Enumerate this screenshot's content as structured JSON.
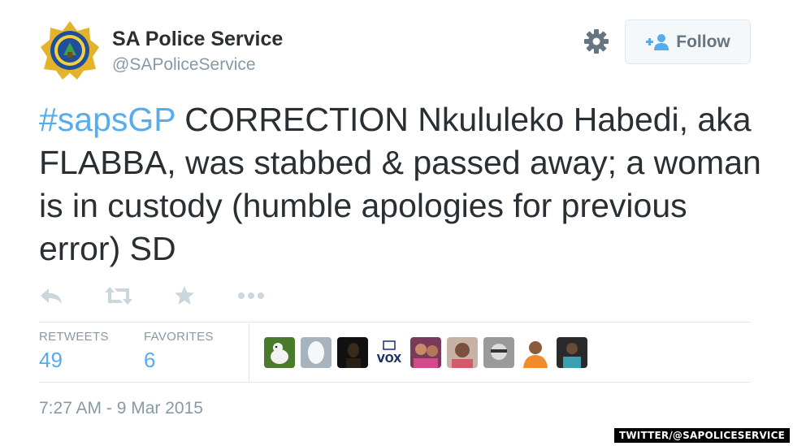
{
  "account": {
    "display_name": "SA Police Service",
    "handle": "@SAPoliceService",
    "avatar_icon": "saps-badge-logo"
  },
  "toolbar": {
    "settings_icon": "gear-icon",
    "follow_label": "Follow",
    "follow_icon": "add-user-icon"
  },
  "tweet": {
    "hashtag": "#sapsGP",
    "text": " CORRECTION Nkululeko Habedi, aka FLABBA, was stabbed & passed away; a woman is in custody (humble apologies for previous error) SD"
  },
  "actions": [
    "reply-icon",
    "retweet-icon",
    "favorite-icon",
    "more-icon"
  ],
  "stats": {
    "retweets_label": "RETWEETS",
    "retweets_count": "49",
    "favorites_label": "FAVORITES",
    "favorites_count": "6"
  },
  "engaged_users": {
    "count_shown": 9,
    "logo_text": "VOX"
  },
  "timestamp": "7:27 AM - 9 Mar 2015",
  "watermark": "TWITTER/@SAPOLICESERVICE",
  "colors": {
    "link": "#55acee",
    "text": "#292f33",
    "muted": "#8899a6",
    "border": "#e1e8ed",
    "icon": "#66757f",
    "action_icon": "#ccd6dd"
  }
}
